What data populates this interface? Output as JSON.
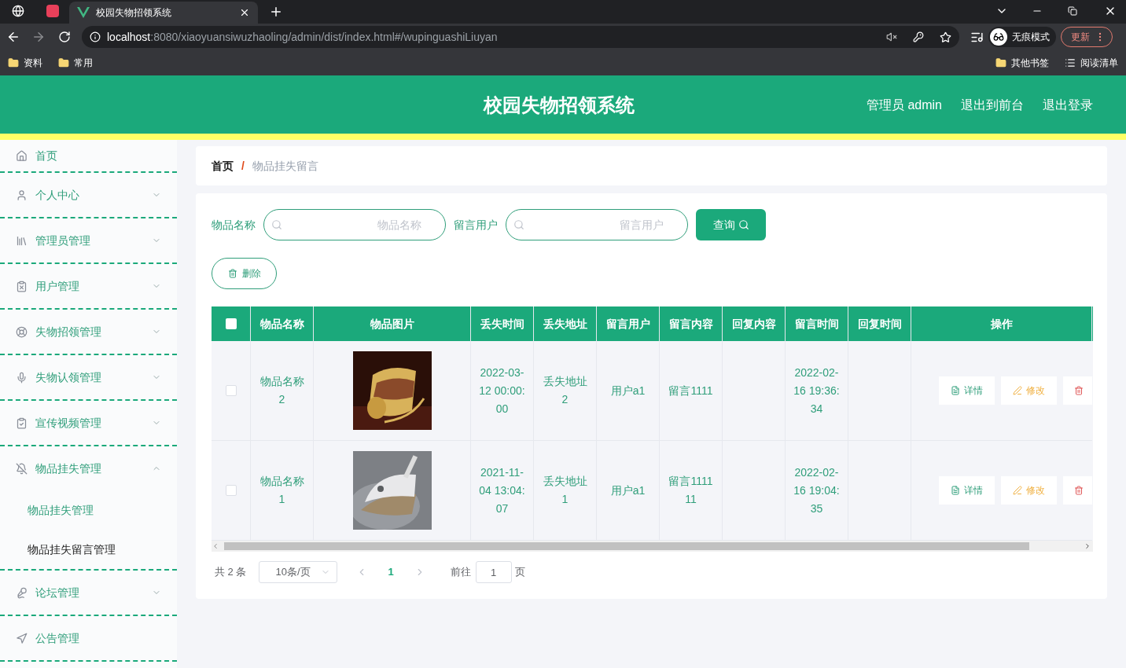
{
  "browser": {
    "tab_title": "校园失物招领系统",
    "url_host": "localhost",
    "url_rest": ":8080/xiaoyuansiwuzhaoling/admin/dist/index.html#/wupinguashiLiuyan",
    "profile": "无痕模式",
    "update": "更新",
    "bookmarks": [
      "资料",
      "常用"
    ],
    "other_bookmarks": "其他书签",
    "reading_list": "阅读清单"
  },
  "header": {
    "title": "校园失物招领系统",
    "links": [
      "管理员 admin",
      "退出到前台",
      "退出登录"
    ]
  },
  "sidebar": {
    "items": [
      {
        "label": "首页"
      },
      {
        "label": "个人中心",
        "expanded": false
      },
      {
        "label": "管理员管理",
        "expanded": false
      },
      {
        "label": "用户管理",
        "expanded": false
      },
      {
        "label": "失物招领管理",
        "expanded": false
      },
      {
        "label": "失物认领管理",
        "expanded": false
      },
      {
        "label": "宣传视频管理",
        "expanded": false
      },
      {
        "label": "物品挂失管理",
        "expanded": true,
        "children": [
          {
            "label": "物品挂失管理",
            "selected": false
          },
          {
            "label": "物品挂失留言管理",
            "selected": true
          }
        ]
      },
      {
        "label": "论坛管理",
        "expanded": false
      },
      {
        "label": "公告管理"
      }
    ]
  },
  "breadcrumb": [
    "首页",
    "/",
    "物品挂失留言"
  ],
  "search": {
    "fields": [
      {
        "label": "物品名称",
        "placeholder": "物品名称"
      },
      {
        "label": "留言用户",
        "placeholder": "留言用户"
      }
    ],
    "button": "查询"
  },
  "delete_button": "删除",
  "table": {
    "header_checked": false,
    "columns": [
      "物品名称",
      "物品图片",
      "丢失时间",
      "丢失地址",
      "留言用户",
      "留言内容",
      "回复内容",
      "留言时间",
      "回复时间",
      "操作"
    ],
    "rows": [
      {
        "checked": false,
        "name": "物品名称2",
        "image": {
          "kind": "picture"
        },
        "lost_time": "2022-03-12 00:00:00",
        "lost_place": "丢失地址2",
        "user": "用户a1",
        "message": "留言1111",
        "message_time": "2022-02-16 19:36:34",
        "actions": [
          "详情",
          "修改"
        ]
      },
      {
        "checked": false,
        "name": "物品名称1",
        "image": {
          "kind": "picture"
        },
        "lost_time": "2021-11-04 13:04:07",
        "lost_place": "丢失地址1",
        "user": "用户a1",
        "message": "留言111111",
        "message_time": "2022-02-16 19:04:35",
        "actions": [
          "详情",
          "修改"
        ]
      }
    ]
  },
  "pagination": {
    "total": "共 2 条",
    "page_size": "10条/页",
    "pages": [
      {
        "label": "1",
        "selected": true
      }
    ],
    "goto_label": "前往",
    "goto_value": "1",
    "goto_suffix": "页"
  }
}
